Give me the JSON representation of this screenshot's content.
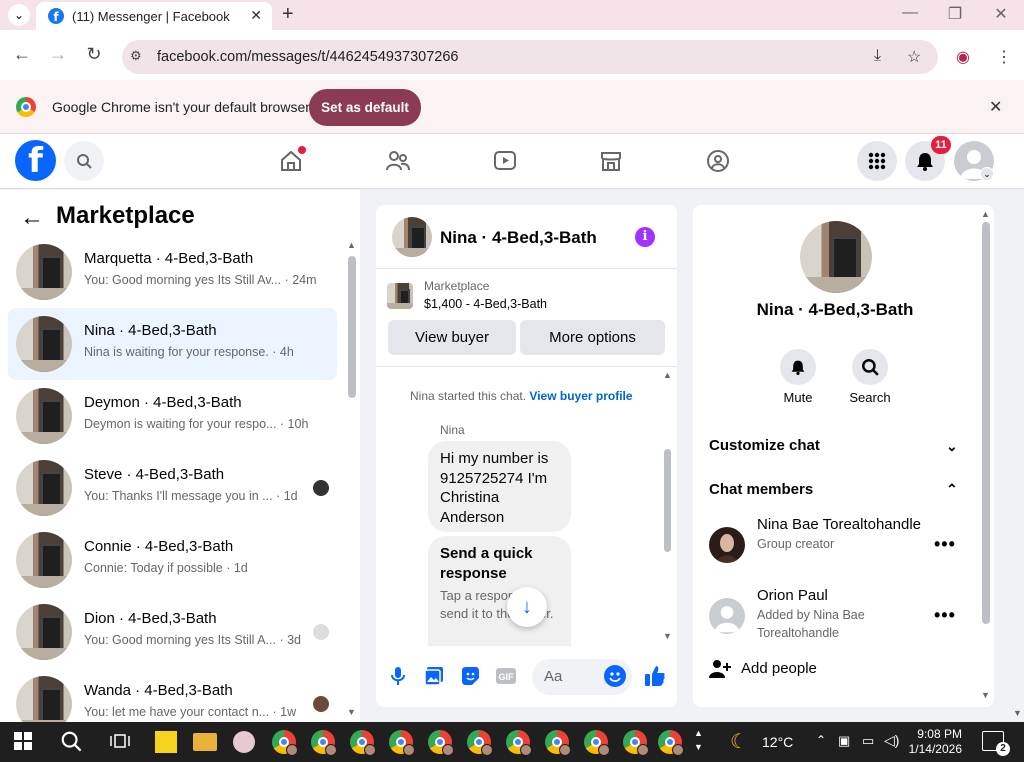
{
  "browser": {
    "tab_title": "(11) Messenger | Facebook",
    "url": "facebook.com/messages/t/4462454937307266",
    "infobar_text": "Google Chrome isn't your default browser",
    "set_default_label": "Set as default"
  },
  "header": {
    "notifications_count": "11"
  },
  "left_panel": {
    "title": "Marketplace",
    "conversations": [
      {
        "name": "Marquetta · 4-Bed,3-Bath",
        "snippet": "You: Good morning yes Its Still Av... · 24m",
        "active": false
      },
      {
        "name": "Nina · 4-Bed,3-Bath",
        "snippet": "Nina is waiting for your response. · 4h",
        "active": true
      },
      {
        "name": "Deymon · 4-Bed,3-Bath",
        "snippet": "Deymon is waiting for your respo... · 10h",
        "active": false
      },
      {
        "name": "Steve · 4-Bed,3-Bath",
        "snippet": "You: Thanks I'll message you in ... · 1d",
        "active": false
      },
      {
        "name": "Connie · 4-Bed,3-Bath",
        "snippet": "Connie: Today if possible · 1d",
        "active": false
      },
      {
        "name": "Dion · 4-Bed,3-Bath",
        "snippet": "You: Good morning yes Its Still A... · 3d",
        "active": false
      },
      {
        "name": "Wanda · 4-Bed,3-Bath",
        "snippet": "You: let me have your contact n... · 1w",
        "active": false
      }
    ]
  },
  "chat": {
    "title": "Nina · 4-Bed,3-Bath",
    "marketplace_label": "Marketplace",
    "listing": "$1,400 - 4-Bed,3-Bath",
    "view_buyer_label": "View buyer",
    "more_options_label": "More options",
    "system_message": "Nina started this chat.",
    "system_link": "View buyer profile",
    "sender": "Nina",
    "message": "Hi my number is 9125725274 I'm Christina Anderson",
    "quick_title": "Send a quick response",
    "quick_sub": "Tap a response to send it to the buyer.",
    "composer_placeholder": "Aa"
  },
  "details": {
    "name": "Nina · 4-Bed,3-Bath",
    "mute_label": "Mute",
    "search_label": "Search",
    "customize_label": "Customize chat",
    "members_label": "Chat members",
    "members": [
      {
        "name": "Nina Bae Torealtohandle",
        "sub": "Group creator"
      },
      {
        "name": "Orion Paul",
        "sub": "Added by Nina Bae Torealtohandle"
      }
    ],
    "add_people_label": "Add people"
  },
  "taskbar": {
    "temperature": "12°C",
    "time": "9:08 PM",
    "date": "1/14/2026",
    "notifications": "2"
  },
  "colors": {
    "facebook_blue": "#0866ff",
    "set_default_bg": "#8c3b54",
    "active_conv_bg": "#ebf5ff",
    "badge_red": "#e41e3f"
  }
}
